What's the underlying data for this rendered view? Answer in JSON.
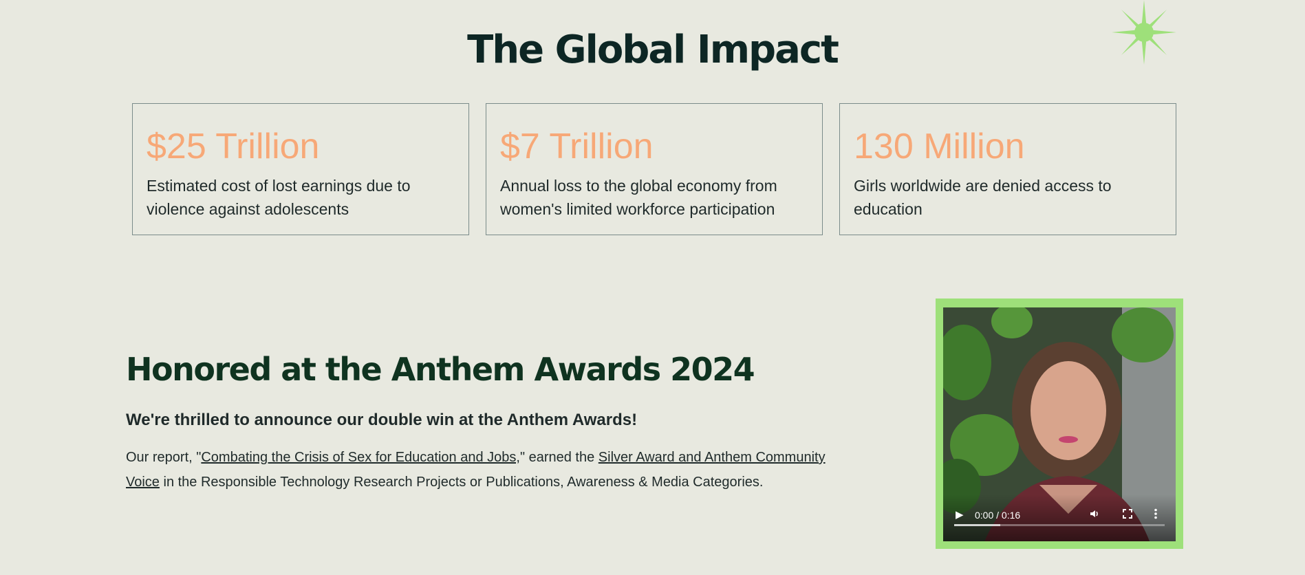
{
  "impact": {
    "title": "The Global Impact",
    "stats": [
      {
        "value": "$25 Trillion",
        "description": "Estimated cost of lost earnings due to violence against adolescents"
      },
      {
        "value": "$7 Trillion",
        "description": "Annual loss to the global economy from women's limited workforce participation"
      },
      {
        "value": "130 Million",
        "description": "Girls worldwide are denied access to education"
      }
    ]
  },
  "awards": {
    "title": "Honored at the Anthem Awards 2024",
    "subtitle": "We're thrilled to announce our double win at the Anthem Awards!",
    "body_prefix": "Our report, \"",
    "report_link": "Combating the Crisis of Sex for Education and Jobs,",
    "body_middle": "\" earned the ",
    "award_link": "Silver Award and Anthem Community Voice",
    "body_suffix": " in the Responsible Technology Research Projects or Publications, Awareness & Media Categories."
  },
  "video": {
    "time_display": "0:00 / 0:16",
    "buffered_fraction": 0.22,
    "icons": {
      "play": "play-icon",
      "volume": "volume-icon",
      "fullscreen": "fullscreen-icon",
      "more": "more-vert-icon"
    }
  },
  "colors": {
    "background": "#e8e9e0",
    "stat_accent": "#f7a877",
    "heading_dark": "#0d2624",
    "awards_heading": "#0f3320",
    "video_frame": "#9ee07a"
  }
}
